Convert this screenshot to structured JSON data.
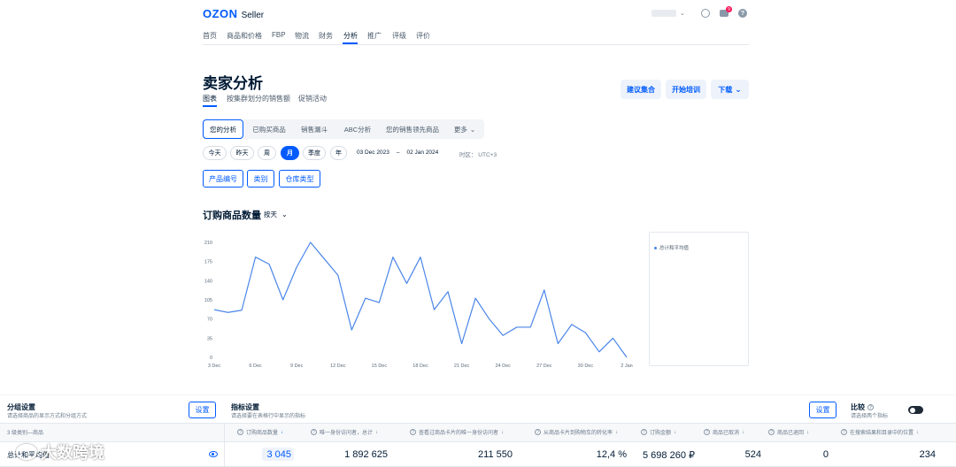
{
  "header": {
    "logo_text": "OZON",
    "logo_suffix": "Seller",
    "notification_badge": "9",
    "icons": [
      "user-icon",
      "chat-icon",
      "help-icon"
    ]
  },
  "nav": {
    "items": [
      {
        "label": "首页"
      },
      {
        "label": "商品和价格"
      },
      {
        "label": "FBP"
      },
      {
        "label": "物流"
      },
      {
        "label": "财务"
      },
      {
        "label": "分析"
      },
      {
        "label": "推广"
      },
      {
        "label": "评级"
      },
      {
        "label": "评价"
      }
    ],
    "active_index": 5
  },
  "page": {
    "title": "卖家分析",
    "tabs": [
      {
        "label": "图表"
      },
      {
        "label": "按集群划分的销售额"
      },
      {
        "label": "促销活动"
      }
    ],
    "active_tab": 0,
    "actions": {
      "suggest": "建议集合",
      "train": "开始培训",
      "download": "下载"
    }
  },
  "subtabs": {
    "items": [
      {
        "label": "您的分析"
      },
      {
        "label": "已购买商品"
      },
      {
        "label": "销售漏斗"
      },
      {
        "label": "ABC分析"
      },
      {
        "label": "您的销售领先商品"
      },
      {
        "label": "更多"
      }
    ],
    "active_index": 0
  },
  "periods": {
    "items": [
      {
        "label": "今天"
      },
      {
        "label": "昨天"
      },
      {
        "label": "周"
      },
      {
        "label": "月"
      },
      {
        "label": "季度"
      },
      {
        "label": "年"
      }
    ],
    "active_index": 3,
    "date_from": "03 Dec 2023",
    "date_sep": "–",
    "date_to": "02 Jan 2024",
    "timezone": "时区： UTC+3"
  },
  "filters": [
    {
      "label": "产品编号"
    },
    {
      "label": "类别"
    },
    {
      "label": "仓库类型"
    }
  ],
  "chart_section": {
    "title": "订购商品数量",
    "granularity": "按天",
    "legend_label": "总计和平均值"
  },
  "chart_data": {
    "type": "line",
    "title": "订购商品数量",
    "xlabel": "",
    "ylabel": "",
    "ylim": [
      0,
      210
    ],
    "yticks": [
      0,
      35,
      70,
      105,
      140,
      175,
      210
    ],
    "xtick_labels": [
      "3 Dec",
      "6 Dec",
      "9 Dec",
      "12 Dec",
      "15 Dec",
      "18 Dec",
      "21 Dec",
      "24 Dec",
      "27 Dec",
      "30 Dec",
      "2 Jan"
    ],
    "x": [
      "3 Dec",
      "4 Dec",
      "5 Dec",
      "6 Dec",
      "7 Dec",
      "8 Dec",
      "9 Dec",
      "10 Dec",
      "11 Dec",
      "12 Dec",
      "13 Dec",
      "14 Dec",
      "15 Dec",
      "16 Dec",
      "17 Dec",
      "18 Dec",
      "19 Dec",
      "20 Dec",
      "21 Dec",
      "22 Dec",
      "23 Dec",
      "24 Dec",
      "25 Dec",
      "26 Dec",
      "27 Dec",
      "28 Dec",
      "29 Dec",
      "30 Dec",
      "31 Dec",
      "1 Jan",
      "2 Jan"
    ],
    "series": [
      {
        "name": "总计和平均值",
        "color": "#4a86e8",
        "values": [
          87,
          82,
          86,
          183,
          170,
          105,
          165,
          210,
          180,
          150,
          50,
          108,
          100,
          183,
          135,
          183,
          87,
          120,
          25,
          108,
          70,
          40,
          55,
          55,
          123,
          25,
          60,
          45,
          10,
          35,
          0
        ]
      }
    ],
    "grid": false,
    "legend_position": "right"
  },
  "settings": {
    "group_title": "分组设置",
    "group_desc": "请选择商品的显示方式和分组方式",
    "group_button": "设置",
    "metrics_title": "指标设置",
    "metrics_desc": "请选择要在表格行中显示的指标",
    "metrics_button": "设置",
    "compare_title": "比较",
    "compare_desc": "请选择两个指标",
    "compare_on": false
  },
  "table": {
    "first_col_header": "3 级类别—商品",
    "columns": [
      {
        "label": "订购商品数量"
      },
      {
        "label": "唯一身份访问者，总计"
      },
      {
        "label": "查看过商品卡片的唯一身份访问者"
      },
      {
        "label": "从商品卡片到购物车的转化率"
      },
      {
        "label": "订购金额"
      },
      {
        "label": "商品已取消"
      },
      {
        "label": "商品已退回"
      },
      {
        "label": "在搜索结果和目录中的位置"
      }
    ],
    "row": {
      "label": "总计和平均值",
      "values": [
        "3 045",
        "1 892 625",
        "211 550",
        "12,4 %",
        "5 698 260 ₽",
        "524",
        "0",
        "234"
      ]
    }
  },
  "watermark": "大数跨境"
}
